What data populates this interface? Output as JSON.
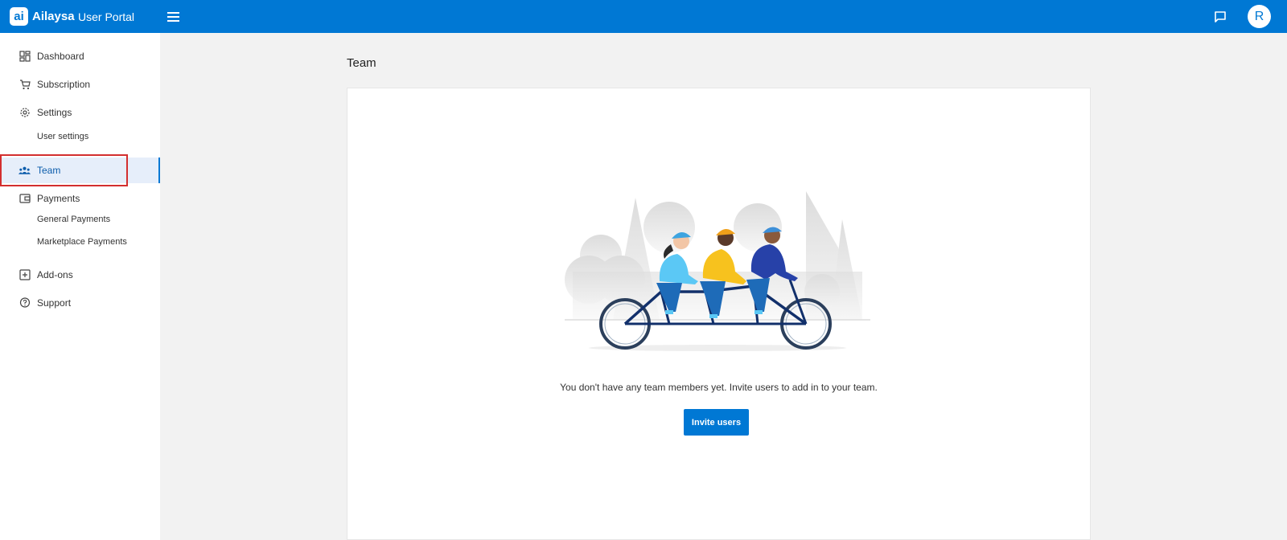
{
  "app": {
    "logo_text": "ai",
    "brand_name": "Ailaysa",
    "brand_sub": "User Portal",
    "menu_icon": "hamburger-icon",
    "chat_icon": "chat-icon",
    "avatar_initial": "R",
    "accent_color": "#0078d4"
  },
  "sidebar": {
    "items": [
      {
        "label": "Dashboard",
        "icon": "dashboard-icon"
      },
      {
        "label": "Subscription",
        "icon": "cart-icon"
      },
      {
        "label": "Settings",
        "icon": "gear-icon"
      },
      {
        "label": "User settings"
      },
      {
        "label": "Team",
        "icon": "team-icon",
        "active": true
      },
      {
        "label": "Payments",
        "icon": "wallet-icon"
      },
      {
        "label": "General Payments"
      },
      {
        "label": "Marketplace Payments"
      },
      {
        "label": "Add-ons",
        "icon": "plus-box-icon"
      },
      {
        "label": "Support",
        "icon": "help-icon"
      }
    ]
  },
  "main": {
    "title": "Team",
    "empty_message": "You don't have any team members yet. Invite users to add in to your team.",
    "invite_button": "Invite users",
    "illustration": "tandem-bicycle-illustration"
  }
}
